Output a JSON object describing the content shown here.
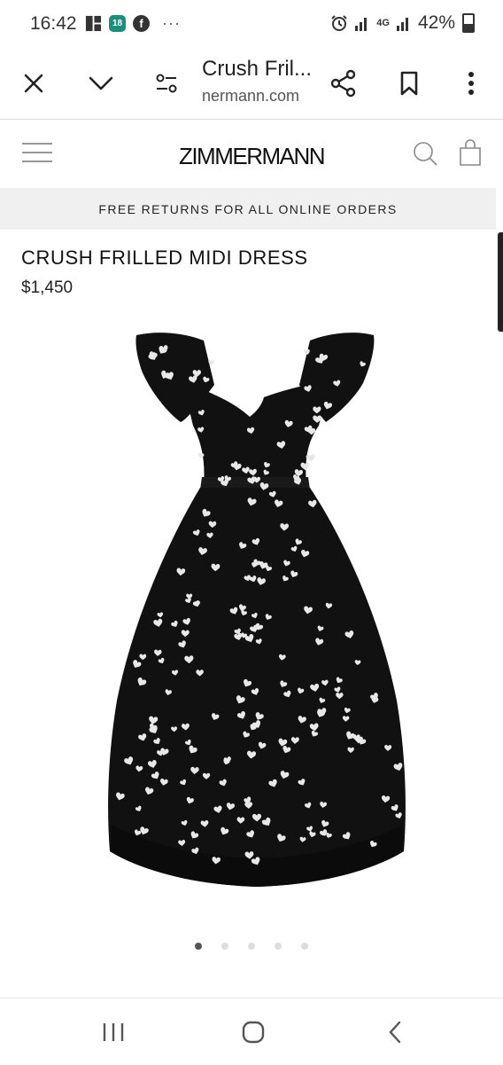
{
  "status_bar": {
    "time": "16:42",
    "calendar_day": "18",
    "more_dots": "···",
    "network": "4G",
    "battery": "42%",
    "icons": [
      "notification-square-icon",
      "calendar-icon",
      "facebook-icon",
      "alarm-icon",
      "signal-icon",
      "battery-icon"
    ]
  },
  "browser": {
    "tab_title": "Crush Fril...",
    "domain": "nermann.com",
    "icons": [
      "close-icon",
      "chevron-down-icon",
      "site-settings-icon",
      "share-icon",
      "bookmark-icon",
      "more-vert-icon"
    ]
  },
  "site": {
    "logo": "ZIMMERMANN",
    "banner": "FREE RETURNS FOR ALL ONLINE ORDERS",
    "icons": [
      "menu-icon",
      "search-icon",
      "bag-icon"
    ]
  },
  "product": {
    "name": "CRUSH FRILLED MIDI DRESS",
    "price": "$1,450",
    "image_count": 5,
    "active_image_index": 0,
    "colors": {
      "dress": "#111111",
      "hearts": "#e8e8e8"
    }
  },
  "nav": {
    "icons": [
      "recents-icon",
      "home-icon",
      "back-icon"
    ]
  }
}
